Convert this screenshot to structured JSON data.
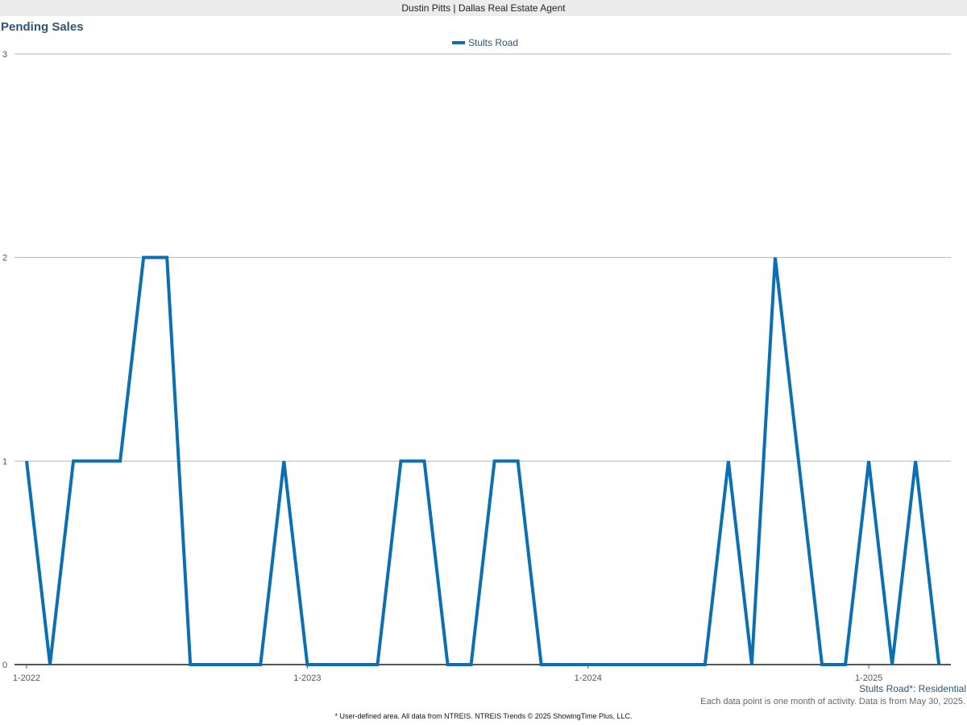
{
  "header": {
    "title": "Dustin Pitts | Dallas Real Estate Agent"
  },
  "chart_title": "Pending Sales",
  "chart_data": {
    "type": "line",
    "title": "Pending Sales",
    "xlabel": "",
    "ylabel": "",
    "ylim": [
      0,
      3
    ],
    "y_ticks": [
      "0",
      "1",
      "2",
      "3"
    ],
    "x_tick_labels": [
      "1-2022",
      "1-2023",
      "1-2024",
      "1-2025"
    ],
    "grid": true,
    "legend_position": "top-center",
    "series": [
      {
        "name": "Stults Road",
        "color": "#0a6fb3",
        "x": [
          "1-2022",
          "2-2022",
          "3-2022",
          "4-2022",
          "5-2022",
          "6-2022",
          "7-2022",
          "8-2022",
          "9-2022",
          "10-2022",
          "11-2022",
          "12-2022",
          "1-2023",
          "2-2023",
          "3-2023",
          "4-2023",
          "5-2023",
          "6-2023",
          "7-2023",
          "8-2023",
          "9-2023",
          "10-2023",
          "11-2023",
          "12-2023",
          "1-2024",
          "2-2024",
          "3-2024",
          "4-2024",
          "5-2024",
          "6-2024",
          "7-2024",
          "8-2024",
          "9-2024",
          "10-2024",
          "11-2024",
          "12-2024",
          "1-2025",
          "2-2025",
          "3-2025",
          "4-2025"
        ],
        "values": [
          1,
          0,
          1,
          1,
          1,
          2,
          2,
          0,
          0,
          0,
          0,
          1,
          0,
          0,
          0,
          0,
          1,
          1,
          0,
          0,
          1,
          1,
          0,
          0,
          0,
          0,
          0,
          0,
          0,
          0,
          1,
          0,
          2,
          1,
          0,
          0,
          1,
          0,
          1,
          0
        ]
      }
    ]
  },
  "footer": {
    "series_label": "Stults Road*: Residential",
    "note": "Each data point is one month of activity. Data is from May 30, 2025.",
    "source": "* User-defined area. All data from NTREIS. NTREIS Trends © 2025 ShowingTime Plus, LLC."
  }
}
